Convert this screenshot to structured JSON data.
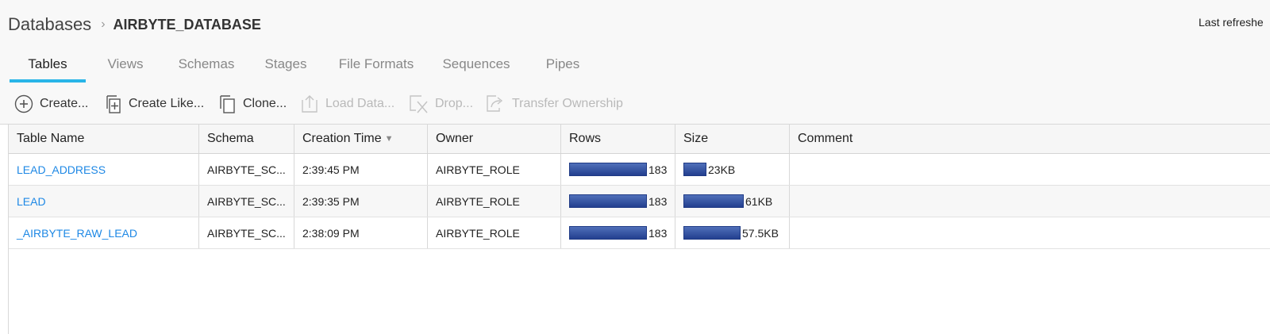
{
  "breadcrumb": {
    "root": "Databases",
    "separator": "›",
    "current": "AIRBYTE_DATABASE"
  },
  "last_refreshed": "Last refreshe",
  "tabs": [
    {
      "label": "Tables",
      "active": true
    },
    {
      "label": "Views"
    },
    {
      "label": "Schemas"
    },
    {
      "label": "Stages"
    },
    {
      "label": "File Formats"
    },
    {
      "label": "Sequences"
    },
    {
      "label": "Pipes"
    }
  ],
  "toolbar": {
    "create": "Create...",
    "create_like": "Create Like...",
    "clone": "Clone...",
    "load_data": "Load Data...",
    "drop": "Drop...",
    "transfer_ownership": "Transfer Ownership"
  },
  "table": {
    "columns": [
      "Table Name",
      "Schema",
      "Creation Time",
      "Owner",
      "Rows",
      "Size",
      "Comment"
    ],
    "sort_indicator": "▼",
    "rows": [
      {
        "name": "LEAD_ADDRESS",
        "schema": "AIRBYTE_SC...",
        "time": "2:39:45 PM",
        "owner": "AIRBYTE_ROLE",
        "rows": "183",
        "rows_fraction": 1.0,
        "size": "23KB",
        "size_fraction": 0.377,
        "comment": ""
      },
      {
        "name": "LEAD",
        "schema": "AIRBYTE_SC...",
        "time": "2:39:35 PM",
        "owner": "AIRBYTE_ROLE",
        "rows": "183",
        "rows_fraction": 1.0,
        "size": "61KB",
        "size_fraction": 1.0,
        "comment": ""
      },
      {
        "name": "_AIRBYTE_RAW_LEAD",
        "schema": "AIRBYTE_SC...",
        "time": "2:38:09 PM",
        "owner": "AIRBYTE_ROLE",
        "rows": "183",
        "rows_fraction": 1.0,
        "size": "57.5KB",
        "size_fraction": 0.943,
        "comment": ""
      }
    ]
  },
  "colors": {
    "accent": "#29b5e8",
    "link": "#1e88e5",
    "bar": "#2d4a9a"
  }
}
